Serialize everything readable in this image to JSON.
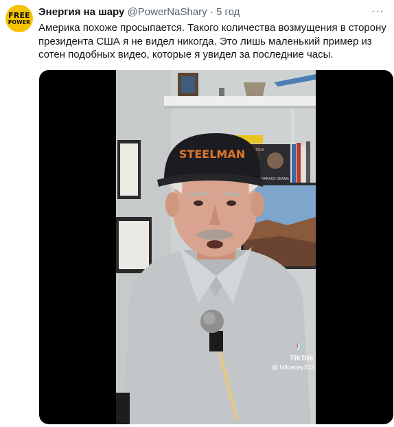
{
  "author": {
    "avatar_line1": "FREE",
    "avatar_line2": "POWER",
    "display_name": "Энергия на шару",
    "handle": "@PowerNaShary",
    "separator": "·",
    "timestamp": "5 год"
  },
  "more_icon": "more-horizontal-icon",
  "tweet": {
    "text": "Америка похоже просыпается. Такого количества возмущения в сторону президента США я не видел никогда. Это лишь маленький пример из сотен подобных видео, которые я увидел за последние часы."
  },
  "video": {
    "cap_text": "STEELMAN",
    "book_author": "DAVID GREENBURGH",
    "book_title": "BARACK OBAMA",
    "watermark_brand": "TikTok",
    "watermark_user": "@ billcarley233",
    "colors": {
      "wall": "#cfd2d3",
      "cap": "#1c1c20",
      "cap_text": "#e0762a",
      "shirt": "#c3c6c8",
      "skin": "#d9a48f"
    }
  }
}
